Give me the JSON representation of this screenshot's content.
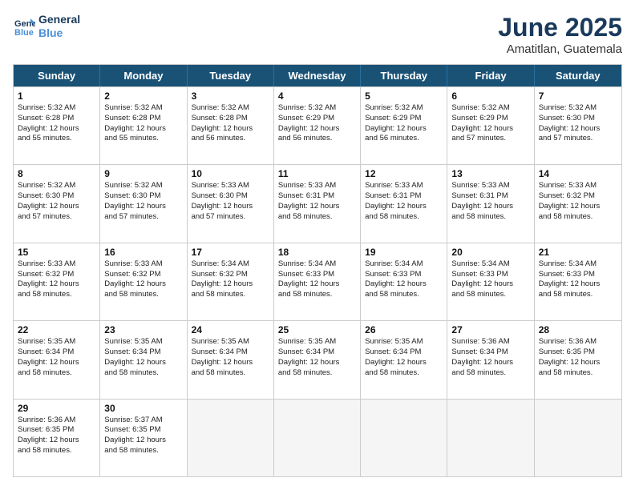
{
  "logo": {
    "line1": "General",
    "line2": "Blue"
  },
  "title": "June 2025",
  "location": "Amatitlan, Guatemala",
  "headers": [
    "Sunday",
    "Monday",
    "Tuesday",
    "Wednesday",
    "Thursday",
    "Friday",
    "Saturday"
  ],
  "rows": [
    [
      {
        "day": "1",
        "lines": [
          "Sunrise: 5:32 AM",
          "Sunset: 6:28 PM",
          "Daylight: 12 hours",
          "and 55 minutes."
        ]
      },
      {
        "day": "2",
        "lines": [
          "Sunrise: 5:32 AM",
          "Sunset: 6:28 PM",
          "Daylight: 12 hours",
          "and 55 minutes."
        ]
      },
      {
        "day": "3",
        "lines": [
          "Sunrise: 5:32 AM",
          "Sunset: 6:28 PM",
          "Daylight: 12 hours",
          "and 56 minutes."
        ]
      },
      {
        "day": "4",
        "lines": [
          "Sunrise: 5:32 AM",
          "Sunset: 6:29 PM",
          "Daylight: 12 hours",
          "and 56 minutes."
        ]
      },
      {
        "day": "5",
        "lines": [
          "Sunrise: 5:32 AM",
          "Sunset: 6:29 PM",
          "Daylight: 12 hours",
          "and 56 minutes."
        ]
      },
      {
        "day": "6",
        "lines": [
          "Sunrise: 5:32 AM",
          "Sunset: 6:29 PM",
          "Daylight: 12 hours",
          "and 57 minutes."
        ]
      },
      {
        "day": "7",
        "lines": [
          "Sunrise: 5:32 AM",
          "Sunset: 6:30 PM",
          "Daylight: 12 hours",
          "and 57 minutes."
        ]
      }
    ],
    [
      {
        "day": "8",
        "lines": [
          "Sunrise: 5:32 AM",
          "Sunset: 6:30 PM",
          "Daylight: 12 hours",
          "and 57 minutes."
        ]
      },
      {
        "day": "9",
        "lines": [
          "Sunrise: 5:32 AM",
          "Sunset: 6:30 PM",
          "Daylight: 12 hours",
          "and 57 minutes."
        ]
      },
      {
        "day": "10",
        "lines": [
          "Sunrise: 5:33 AM",
          "Sunset: 6:30 PM",
          "Daylight: 12 hours",
          "and 57 minutes."
        ]
      },
      {
        "day": "11",
        "lines": [
          "Sunrise: 5:33 AM",
          "Sunset: 6:31 PM",
          "Daylight: 12 hours",
          "and 58 minutes."
        ]
      },
      {
        "day": "12",
        "lines": [
          "Sunrise: 5:33 AM",
          "Sunset: 6:31 PM",
          "Daylight: 12 hours",
          "and 58 minutes."
        ]
      },
      {
        "day": "13",
        "lines": [
          "Sunrise: 5:33 AM",
          "Sunset: 6:31 PM",
          "Daylight: 12 hours",
          "and 58 minutes."
        ]
      },
      {
        "day": "14",
        "lines": [
          "Sunrise: 5:33 AM",
          "Sunset: 6:32 PM",
          "Daylight: 12 hours",
          "and 58 minutes."
        ]
      }
    ],
    [
      {
        "day": "15",
        "lines": [
          "Sunrise: 5:33 AM",
          "Sunset: 6:32 PM",
          "Daylight: 12 hours",
          "and 58 minutes."
        ]
      },
      {
        "day": "16",
        "lines": [
          "Sunrise: 5:33 AM",
          "Sunset: 6:32 PM",
          "Daylight: 12 hours",
          "and 58 minutes."
        ]
      },
      {
        "day": "17",
        "lines": [
          "Sunrise: 5:34 AM",
          "Sunset: 6:32 PM",
          "Daylight: 12 hours",
          "and 58 minutes."
        ]
      },
      {
        "day": "18",
        "lines": [
          "Sunrise: 5:34 AM",
          "Sunset: 6:33 PM",
          "Daylight: 12 hours",
          "and 58 minutes."
        ]
      },
      {
        "day": "19",
        "lines": [
          "Sunrise: 5:34 AM",
          "Sunset: 6:33 PM",
          "Daylight: 12 hours",
          "and 58 minutes."
        ]
      },
      {
        "day": "20",
        "lines": [
          "Sunrise: 5:34 AM",
          "Sunset: 6:33 PM",
          "Daylight: 12 hours",
          "and 58 minutes."
        ]
      },
      {
        "day": "21",
        "lines": [
          "Sunrise: 5:34 AM",
          "Sunset: 6:33 PM",
          "Daylight: 12 hours",
          "and 58 minutes."
        ]
      }
    ],
    [
      {
        "day": "22",
        "lines": [
          "Sunrise: 5:35 AM",
          "Sunset: 6:34 PM",
          "Daylight: 12 hours",
          "and 58 minutes."
        ]
      },
      {
        "day": "23",
        "lines": [
          "Sunrise: 5:35 AM",
          "Sunset: 6:34 PM",
          "Daylight: 12 hours",
          "and 58 minutes."
        ]
      },
      {
        "day": "24",
        "lines": [
          "Sunrise: 5:35 AM",
          "Sunset: 6:34 PM",
          "Daylight: 12 hours",
          "and 58 minutes."
        ]
      },
      {
        "day": "25",
        "lines": [
          "Sunrise: 5:35 AM",
          "Sunset: 6:34 PM",
          "Daylight: 12 hours",
          "and 58 minutes."
        ]
      },
      {
        "day": "26",
        "lines": [
          "Sunrise: 5:35 AM",
          "Sunset: 6:34 PM",
          "Daylight: 12 hours",
          "and 58 minutes."
        ]
      },
      {
        "day": "27",
        "lines": [
          "Sunrise: 5:36 AM",
          "Sunset: 6:34 PM",
          "Daylight: 12 hours",
          "and 58 minutes."
        ]
      },
      {
        "day": "28",
        "lines": [
          "Sunrise: 5:36 AM",
          "Sunset: 6:35 PM",
          "Daylight: 12 hours",
          "and 58 minutes."
        ]
      }
    ],
    [
      {
        "day": "29",
        "lines": [
          "Sunrise: 5:36 AM",
          "Sunset: 6:35 PM",
          "Daylight: 12 hours",
          "and 58 minutes."
        ]
      },
      {
        "day": "30",
        "lines": [
          "Sunrise: 5:37 AM",
          "Sunset: 6:35 PM",
          "Daylight: 12 hours",
          "and 58 minutes."
        ]
      },
      {
        "day": "",
        "lines": []
      },
      {
        "day": "",
        "lines": []
      },
      {
        "day": "",
        "lines": []
      },
      {
        "day": "",
        "lines": []
      },
      {
        "day": "",
        "lines": []
      }
    ]
  ]
}
